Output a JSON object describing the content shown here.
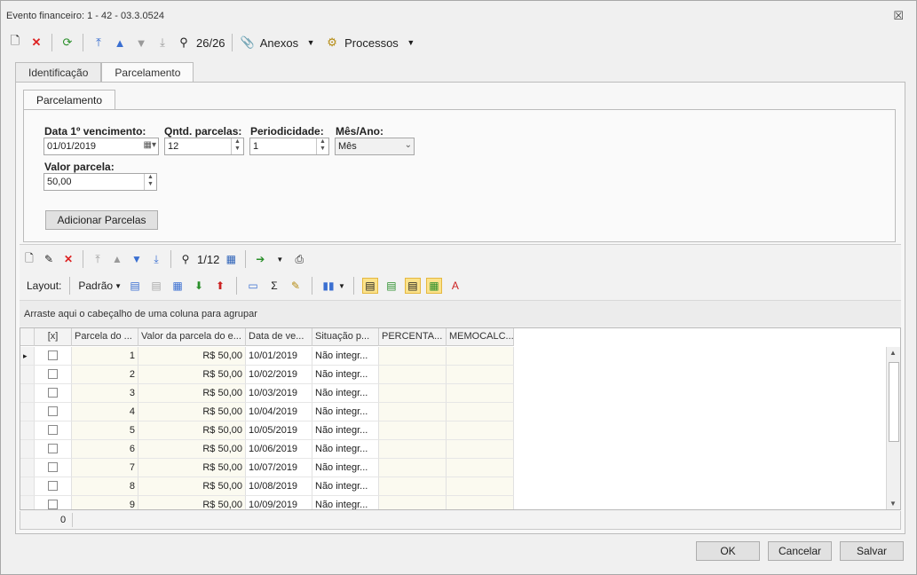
{
  "window": {
    "title": "Evento financeiro: 1 - 42 - 03.3.0524",
    "close_glyph": "☒"
  },
  "toolbar": {
    "record_count": "26/26",
    "anexos_label": "Anexos",
    "processos_label": "Processos"
  },
  "tabs": [
    "Identificação",
    "Parcelamento"
  ],
  "inner_tab": "Parcelamento",
  "form": {
    "data_label": "Data 1º vencimento:",
    "data_value": "01/01/2019",
    "qtd_label": "Qntd. parcelas:",
    "qtd_value": "12",
    "period_label": "Periodicidade:",
    "period_value": "1",
    "mesano_label": "Mês/Ano:",
    "mesano_value": "Mês",
    "valor_label": "Valor parcela:",
    "valor_value": "50,00",
    "add_button": "Adicionar Parcelas"
  },
  "grid_toolbar": {
    "record_count": "1/12",
    "layout_label": "Layout:",
    "padrao_label": "Padrão"
  },
  "group_hint": "Arraste aqui o cabeçalho de uma coluna para agrupar",
  "columns": [
    "[x]",
    "Parcela do ...",
    "Valor da parcela do e...",
    "Data de ve...",
    "Situação p...",
    "PERCENTA...",
    "MEMOCALC..."
  ],
  "rows": [
    {
      "parcela": "1",
      "valor": "R$ 50,00",
      "data": "10/01/2019",
      "situacao": "Não integr..."
    },
    {
      "parcela": "2",
      "valor": "R$ 50,00",
      "data": "10/02/2019",
      "situacao": "Não integr..."
    },
    {
      "parcela": "3",
      "valor": "R$ 50,00",
      "data": "10/03/2019",
      "situacao": "Não integr..."
    },
    {
      "parcela": "4",
      "valor": "R$ 50,00",
      "data": "10/04/2019",
      "situacao": "Não integr..."
    },
    {
      "parcela": "5",
      "valor": "R$ 50,00",
      "data": "10/05/2019",
      "situacao": "Não integr..."
    },
    {
      "parcela": "6",
      "valor": "R$ 50,00",
      "data": "10/06/2019",
      "situacao": "Não integr..."
    },
    {
      "parcela": "7",
      "valor": "R$ 50,00",
      "data": "10/07/2019",
      "situacao": "Não integr..."
    },
    {
      "parcela": "8",
      "valor": "R$ 50,00",
      "data": "10/08/2019",
      "situacao": "Não integr..."
    },
    {
      "parcela": "9",
      "valor": "R$ 50,00",
      "data": "10/09/2019",
      "situacao": "Não integr..."
    }
  ],
  "footer_count": "0",
  "buttons": {
    "ok": "OK",
    "cancel": "Cancelar",
    "save": "Salvar"
  }
}
